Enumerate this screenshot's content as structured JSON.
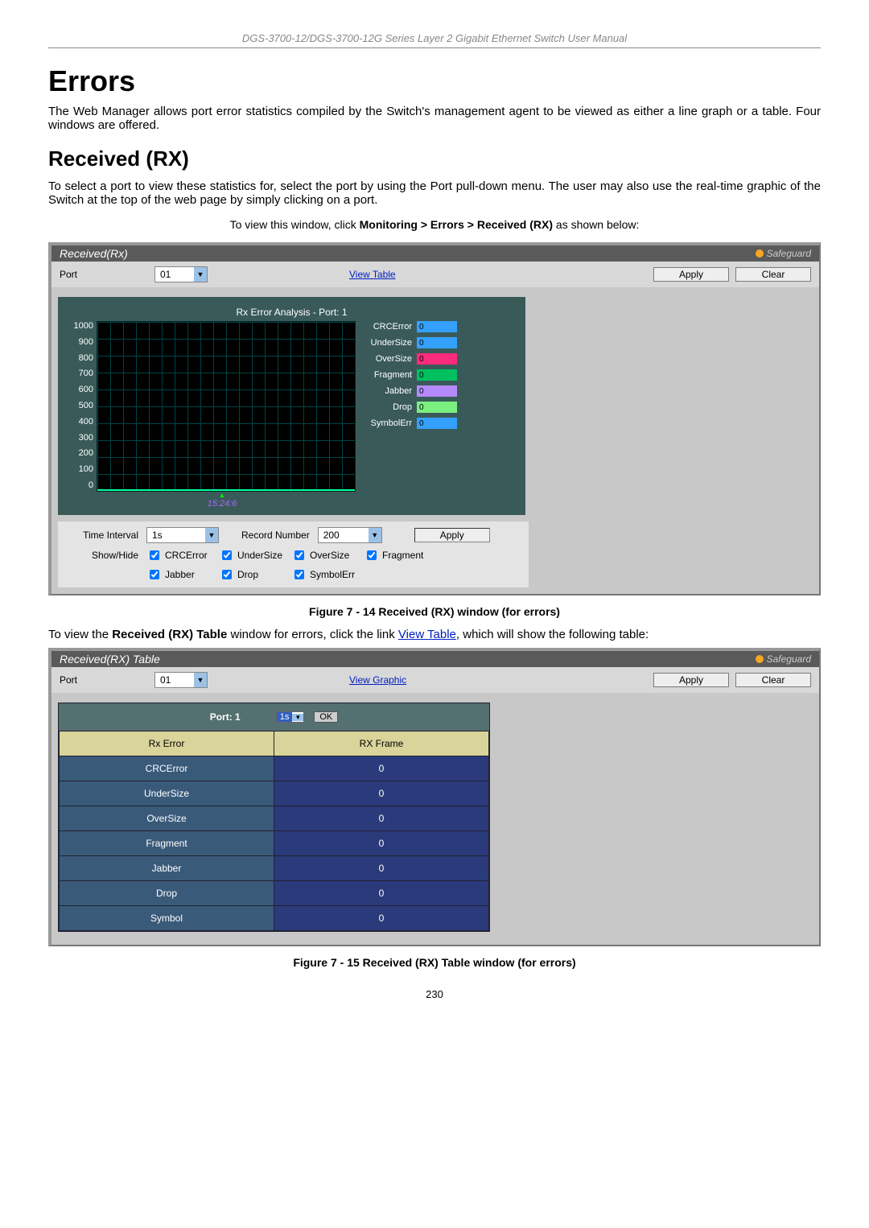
{
  "header": "DGS-3700-12/DGS-3700-12G Series Layer 2 Gigabit Ethernet Switch User Manual",
  "h1": "Errors",
  "intro1": "The Web Manager allows port error statistics compiled by the Switch's management agent to be viewed as either a line graph or a table. Four windows are offered.",
  "h2": "Received (RX)",
  "intro2": "To select a port to view these statistics for, select the port by using the Port pull-down menu. The user may also use the real-time graphic of the Switch at the top of the web page by simply clicking on a port.",
  "nav_prefix": "To view this window, click ",
  "nav_path": "Monitoring > Errors > Received (RX)",
  "nav_suffix": " as shown below:",
  "safeguard": "Safeguard",
  "panel1": {
    "title": "Received(Rx)",
    "port_label": "Port",
    "port_value": "01",
    "view_link": "View Table",
    "apply": "Apply",
    "clear": "Clear"
  },
  "chart_data": {
    "type": "line",
    "title": "Rx Error Analysis - Port: 1",
    "ylim": [
      0,
      1000
    ],
    "y_ticks": [
      "1000",
      "900",
      "800",
      "700",
      "600",
      "500",
      "400",
      "300",
      "200",
      "100",
      "0"
    ],
    "x_label": "15:24:6",
    "series": [
      {
        "name": "CRCError",
        "value": 0,
        "color": "#34a1ff"
      },
      {
        "name": "UnderSize",
        "value": 0,
        "color": "#34a1ff"
      },
      {
        "name": "OverSize",
        "value": 0,
        "color": "#ff2a7a"
      },
      {
        "name": "Fragment",
        "value": 0,
        "color": "#00c060"
      },
      {
        "name": "Jabber",
        "value": 0,
        "color": "#b58aff"
      },
      {
        "name": "Drop",
        "value": 0,
        "color": "#7af080"
      },
      {
        "name": "SymbolErr",
        "value": 0,
        "color": "#34a1ff"
      }
    ]
  },
  "options": {
    "time_interval_label": "Time Interval",
    "time_interval_value": "1s",
    "record_number_label": "Record Number",
    "record_number_value": "200",
    "apply": "Apply",
    "showhide_label": "Show/Hide",
    "checks_row1": [
      "CRCError",
      "UnderSize",
      "OverSize",
      "Fragment"
    ],
    "checks_row2": [
      "Jabber",
      "Drop",
      "SymbolErr"
    ]
  },
  "fig1": "Figure 7 - 14 Received (RX) window (for errors)",
  "mid_prefix": "To view the ",
  "mid_bold": "Received (RX) Table",
  "mid_mid": " window for errors, click the link ",
  "mid_link": "View Table",
  "mid_suffix": ", which will show the following table:",
  "panel2": {
    "title": "Received(RX) Table",
    "port_label": "Port",
    "port_value": "01",
    "view_link": "View Graphic",
    "apply": "Apply",
    "clear": "Clear",
    "port_header": "Port: 1",
    "interval": "1s",
    "ok": "OK"
  },
  "table": {
    "head1": "Rx Error",
    "head2": "RX Frame",
    "rows": [
      {
        "name": "CRCError",
        "val": "0"
      },
      {
        "name": "UnderSize",
        "val": "0"
      },
      {
        "name": "OverSize",
        "val": "0"
      },
      {
        "name": "Fragment",
        "val": "0"
      },
      {
        "name": "Jabber",
        "val": "0"
      },
      {
        "name": "Drop",
        "val": "0"
      },
      {
        "name": "Symbol",
        "val": "0"
      }
    ]
  },
  "fig2": "Figure 7 - 15 Received (RX) Table window (for errors)",
  "page_num": "230"
}
